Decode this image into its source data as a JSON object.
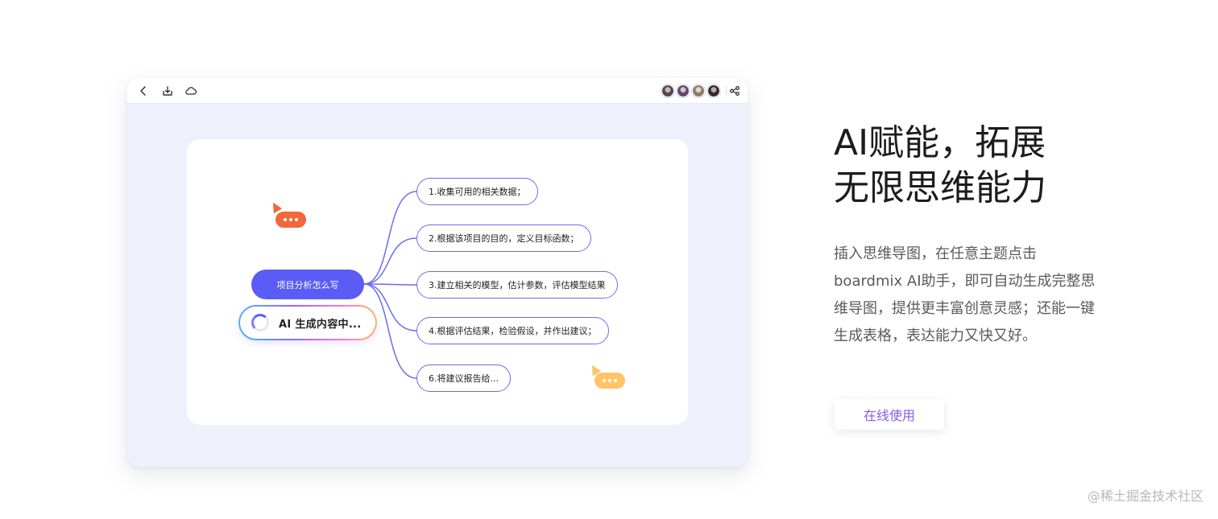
{
  "mindmap": {
    "root_label": "项目分析怎么写",
    "ai_status": "AI 生成内容中...",
    "children": [
      "1.收集可用的相关数据；",
      "2.根据该项目的目的，定义目标函数；",
      "3.建立相关的模型，估计参数，评估模型结果",
      "4.根据评估结果，检验假设，并作出建议；",
      "6.将建议报告给..."
    ]
  },
  "content": {
    "headline_line1": "AI赋能，拓展",
    "headline_line2": "无限思维能力",
    "description": "插入思维导图，在任意主题点击boardmix AI助手，即可自动生成完整思维导图，提供更丰富创意灵感；还能一键生成表格，表达能力又快又好。",
    "cta_label": "在线使用"
  },
  "watermark": "@稀土掘金技术社区",
  "colors": {
    "accent": "#5a5cf5",
    "branch": "#6a6cf2",
    "cta_text": "#7d5cf0",
    "bubble_orange": "#f2683a",
    "bubble_yellow": "#ffc466"
  },
  "icons": [
    "back-icon",
    "download-icon",
    "cloud-icon",
    "share-icon"
  ]
}
